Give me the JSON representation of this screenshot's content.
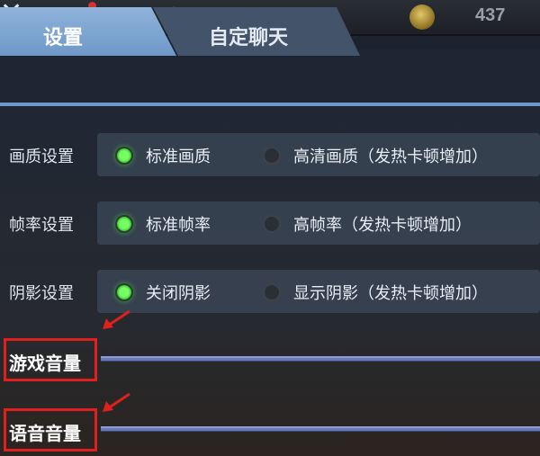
{
  "topbar": {
    "close_icon": "✕",
    "mail_icon": "mail-icon",
    "gear_icon": "⚙",
    "coin_icon": "coin-icon",
    "coin_count": "437"
  },
  "tabs": [
    {
      "label": "设置",
      "active": true
    },
    {
      "label": "自定聊天",
      "active": false
    }
  ],
  "settings": [
    {
      "label": "画质设置",
      "options": [
        {
          "text": "标准画质",
          "selected": true
        },
        {
          "text": "高清画质（发热卡顿增加）",
          "selected": false
        }
      ]
    },
    {
      "label": "帧率设置",
      "options": [
        {
          "text": "标准帧率",
          "selected": true
        },
        {
          "text": "高帧率（发热卡顿增加）",
          "selected": false
        }
      ]
    },
    {
      "label": "阴影设置",
      "options": [
        {
          "text": "关闭阴影",
          "selected": true
        },
        {
          "text": "显示阴影（发热卡顿增加）",
          "selected": false
        }
      ]
    }
  ],
  "volume": {
    "game_label": "游戏音量",
    "voice_label": "语音音量"
  },
  "colors": {
    "accent_tab": "#7fa6d4",
    "radio_on": "#4fe040",
    "annotation_red": "#e0201c"
  }
}
